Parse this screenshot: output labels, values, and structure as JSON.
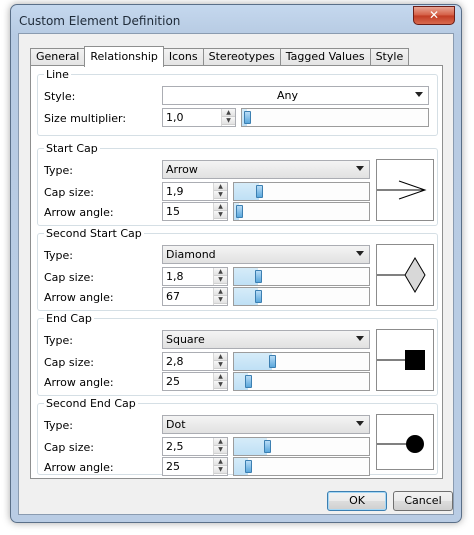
{
  "window": {
    "title": "Custom Element Definition",
    "close_symbol": "✕"
  },
  "tabs": [
    {
      "label": "General",
      "active": false
    },
    {
      "label": "Relationship",
      "active": true
    },
    {
      "label": "Icons",
      "active": false
    },
    {
      "label": "Stereotypes",
      "active": false
    },
    {
      "label": "Tagged Values",
      "active": false
    },
    {
      "label": "Style",
      "active": false
    }
  ],
  "line": {
    "title": "Line",
    "style_label": "Style:",
    "style_value": "Any",
    "size_label": "Size multiplier:",
    "size_value": "1,0",
    "size_slider_fraction": 0.0
  },
  "caps": [
    {
      "title": "Start Cap",
      "type_label": "Type:",
      "type_value": "Arrow",
      "size_label": "Cap size:",
      "size_value": "1,9",
      "size_slider_fraction": 0.16,
      "angle_label": "Arrow angle:",
      "angle_value": "15",
      "angle_slider_fraction": 0.0,
      "preview": "arrow"
    },
    {
      "title": "Second Start Cap",
      "type_label": "Type:",
      "type_value": "Diamond",
      "size_label": "Cap size:",
      "size_value": "1,8",
      "size_slider_fraction": 0.15,
      "angle_label": "Arrow angle:",
      "angle_value": "67",
      "angle_slider_fraction": 0.15,
      "preview": "diamond"
    },
    {
      "title": "End Cap",
      "type_label": "Type:",
      "type_value": "Square",
      "size_label": "Cap size:",
      "size_value": "2,8",
      "size_slider_fraction": 0.26,
      "angle_label": "Arrow angle:",
      "angle_value": "25",
      "angle_slider_fraction": 0.07,
      "preview": "square"
    },
    {
      "title": "Second End Cap",
      "type_label": "Type:",
      "type_value": "Dot",
      "size_label": "Cap size:",
      "size_value": "2,5",
      "size_slider_fraction": 0.22,
      "angle_label": "Arrow angle:",
      "angle_value": "25",
      "angle_slider_fraction": 0.07,
      "preview": "dot"
    }
  ],
  "buttons": {
    "ok": "OK",
    "cancel": "Cancel"
  },
  "icons": {
    "spin_up": "▲",
    "spin_down": "▼"
  }
}
